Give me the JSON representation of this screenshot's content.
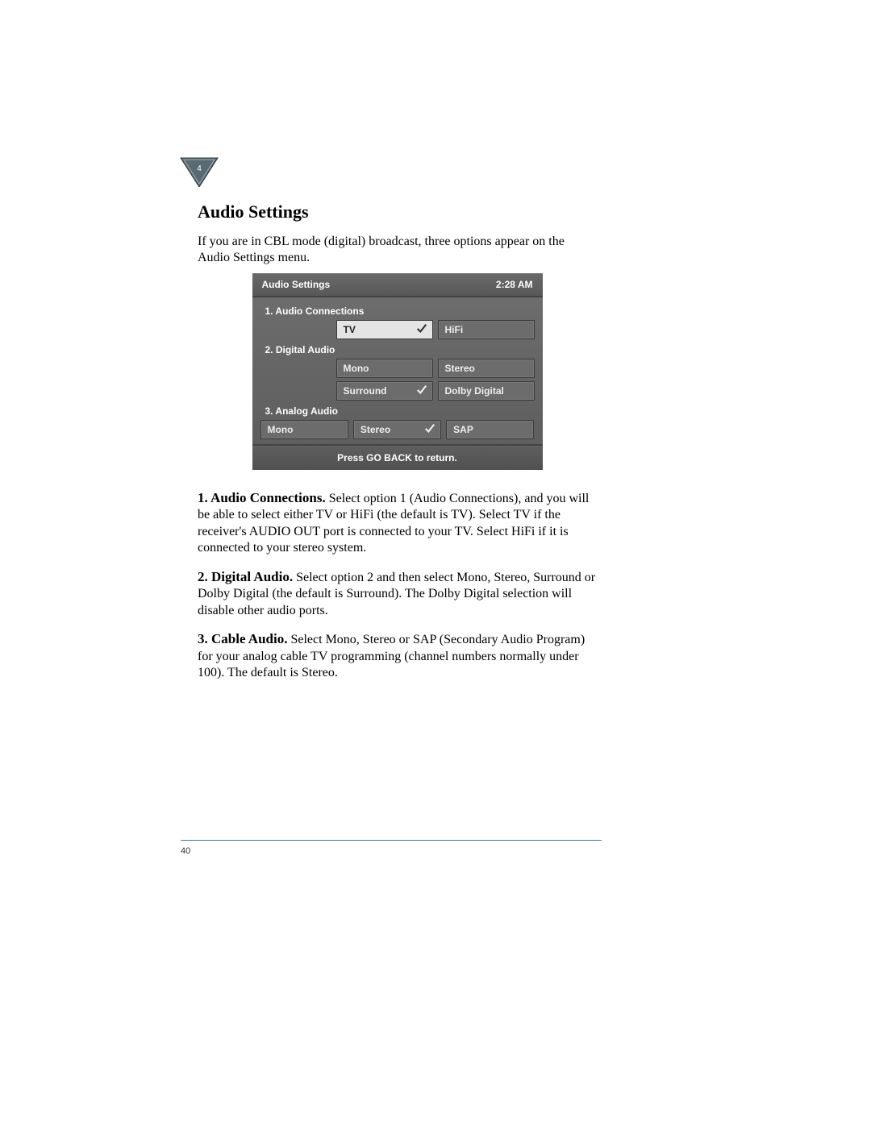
{
  "chapter_marker": "4",
  "heading": "Audio Settings",
  "intro": "If you are in CBL mode (digital) broadcast, three options appear on the Audio Settings menu.",
  "osd": {
    "title": "Audio Settings",
    "clock": "2:28 AM",
    "sections": [
      {
        "label": "1.  Audio Connections",
        "rows": [
          [
            {
              "text": "TV",
              "selected": true,
              "checked": true
            },
            {
              "text": "HiFi",
              "selected": false,
              "checked": false
            }
          ]
        ],
        "indent": true
      },
      {
        "label": "2.  Digital Audio",
        "rows": [
          [
            {
              "text": "Mono",
              "selected": false,
              "checked": false
            },
            {
              "text": "Stereo",
              "selected": false,
              "checked": false
            }
          ],
          [
            {
              "text": "Surround",
              "selected": false,
              "checked": true
            },
            {
              "text": "Dolby Digital",
              "selected": false,
              "checked": false
            }
          ]
        ],
        "indent": true
      },
      {
        "label": "3.  Analog Audio",
        "rows": [
          [
            {
              "text": "Mono",
              "selected": false,
              "checked": false
            },
            {
              "text": "Stereo",
              "selected": false,
              "checked": true
            },
            {
              "text": "SAP",
              "selected": false,
              "checked": false
            }
          ]
        ],
        "indent": false
      }
    ],
    "footer": "Press GO BACK to return."
  },
  "paragraphs": [
    {
      "lead": "1. Audio Connections.",
      "text": " Select option 1 (Audio Connections), and you will be able to select either TV or HiFi (the default is TV). Select TV if the receiver's AUDIO OUT port is connected to your TV. Select HiFi if it is connected to your stereo system."
    },
    {
      "lead": "2. Digital Audio.",
      "text": " Select option 2 and then select Mono, Stereo, Surround or Dolby Digital (the default is Surround). The Dolby Digital selection will disable other audio ports."
    },
    {
      "lead": "3. Cable Audio.",
      "text": " Select Mono, Stereo or SAP (Secondary Audio Program) for your analog cable TV programming (channel numbers normally under 100). The default is Stereo."
    }
  ],
  "page_number": "40"
}
